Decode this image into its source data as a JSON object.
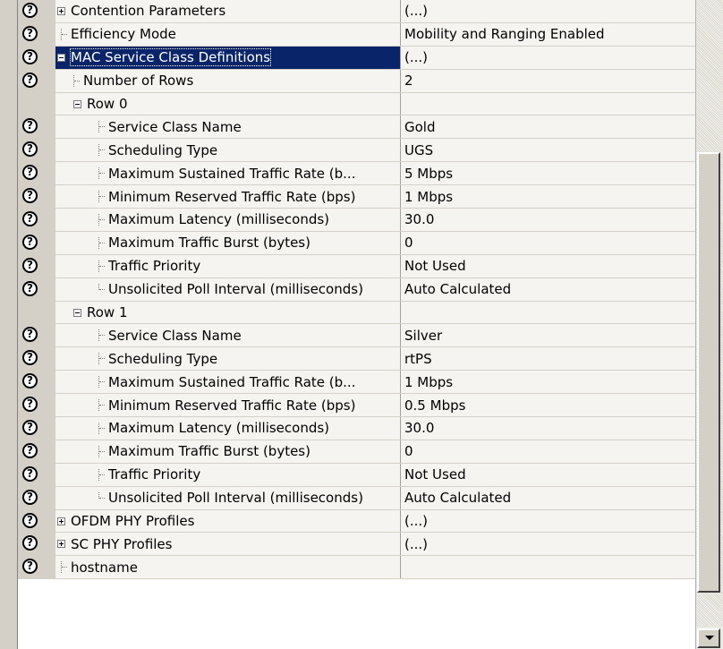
{
  "rows": [
    {
      "kind": "cat",
      "help": true,
      "expander": "plus",
      "label": "Contention Parameters",
      "value": "(...)",
      "level": 0
    },
    {
      "kind": "leaf",
      "help": true,
      "label": "Efficiency Mode",
      "value": "Mobility and Ranging Enabled",
      "level": 0
    },
    {
      "kind": "cat",
      "help": true,
      "expander": "minus",
      "label": "MAC Service Class Definitions",
      "value": "(...)",
      "level": 0,
      "selected": true
    },
    {
      "kind": "leaf",
      "help": true,
      "label": "Number of Rows",
      "value": "2",
      "level": 1
    },
    {
      "kind": "cat",
      "help": false,
      "expander": "minus",
      "label": "Row 0",
      "value": "",
      "level": 1
    },
    {
      "kind": "leaf",
      "help": true,
      "label": "Service Class Name",
      "value": "Gold",
      "level": 2
    },
    {
      "kind": "leaf",
      "help": true,
      "label": "Scheduling Type",
      "value": "UGS",
      "level": 2
    },
    {
      "kind": "leaf",
      "help": true,
      "label": "Maximum Sustained Traffic Rate (b...",
      "value": "5 Mbps",
      "level": 2
    },
    {
      "kind": "leaf",
      "help": true,
      "label": "Minimum Reserved Traffic Rate (bps)",
      "value": "1 Mbps",
      "level": 2
    },
    {
      "kind": "leaf",
      "help": true,
      "label": "Maximum Latency (milliseconds)",
      "value": "30.0",
      "level": 2
    },
    {
      "kind": "leaf",
      "help": true,
      "label": "Maximum Traffic Burst (bytes)",
      "value": "0",
      "level": 2
    },
    {
      "kind": "leaf",
      "help": true,
      "label": "Traffic Priority",
      "value": "Not Used",
      "level": 2
    },
    {
      "kind": "leaf",
      "help": true,
      "label": "Unsolicited Poll Interval (milliseconds)",
      "value": "Auto Calculated",
      "level": 2,
      "last": true
    },
    {
      "kind": "cat",
      "help": false,
      "expander": "minus",
      "label": "Row 1",
      "value": "",
      "level": 1
    },
    {
      "kind": "leaf",
      "help": true,
      "label": "Service Class Name",
      "value": "Silver",
      "level": 2
    },
    {
      "kind": "leaf",
      "help": true,
      "label": "Scheduling Type",
      "value": "rtPS",
      "level": 2
    },
    {
      "kind": "leaf",
      "help": true,
      "label": "Maximum Sustained Traffic Rate (b...",
      "value": "1 Mbps",
      "level": 2
    },
    {
      "kind": "leaf",
      "help": true,
      "label": "Minimum Reserved Traffic Rate (bps)",
      "value": "0.5 Mbps",
      "level": 2
    },
    {
      "kind": "leaf",
      "help": true,
      "label": "Maximum Latency (milliseconds)",
      "value": "30.0",
      "level": 2
    },
    {
      "kind": "leaf",
      "help": true,
      "label": "Maximum Traffic Burst (bytes)",
      "value": "0",
      "level": 2
    },
    {
      "kind": "leaf",
      "help": true,
      "label": "Traffic Priority",
      "value": "Not Used",
      "level": 2
    },
    {
      "kind": "leaf",
      "help": true,
      "label": "Unsolicited Poll Interval (milliseconds)",
      "value": "Auto Calculated",
      "level": 2,
      "last": true
    },
    {
      "kind": "cat",
      "help": true,
      "expander": "plus",
      "label": "OFDM PHY Profiles",
      "value": "(...)",
      "level": 0
    },
    {
      "kind": "cat",
      "help": true,
      "expander": "plus",
      "label": "SC PHY Profiles",
      "value": "(...)",
      "level": 0
    },
    {
      "kind": "leaf",
      "help": true,
      "label": "hostname",
      "value": "",
      "level": 0
    }
  ],
  "help_glyph": "?",
  "icons": {
    "help": "help-icon",
    "expand": "expand-plus-icon",
    "collapse": "collapse-minus-icon",
    "scroll_down": "scroll-down-arrow-icon"
  },
  "colors": {
    "selection": "#0a246a",
    "gutter": "#d4d0c8",
    "cell": "#f5f4f0"
  }
}
